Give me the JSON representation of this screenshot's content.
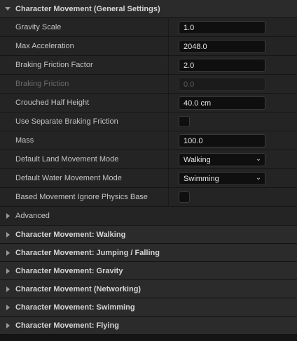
{
  "main_section": {
    "title": "Character Movement (General Settings)",
    "expanded": true,
    "arrow_icon": "chevron-down-icon"
  },
  "properties": [
    {
      "label": "Gravity Scale",
      "type": "number",
      "value": "1.0",
      "enabled": true
    },
    {
      "label": "Max Acceleration",
      "type": "number",
      "value": "2048.0",
      "enabled": true
    },
    {
      "label": "Braking Friction Factor",
      "type": "number",
      "value": "2.0",
      "enabled": true
    },
    {
      "label": "Braking Friction",
      "type": "number",
      "value": "0.0",
      "enabled": false
    },
    {
      "label": "Crouched Half Height",
      "type": "number",
      "value": "40.0 cm",
      "enabled": true
    },
    {
      "label": "Use Separate Braking Friction",
      "type": "checkbox",
      "checked": false,
      "enabled": true
    },
    {
      "label": "Mass",
      "type": "number",
      "value": "100.0",
      "enabled": true
    },
    {
      "label": "Default Land Movement Mode",
      "type": "dropdown",
      "value": "Walking",
      "enabled": true
    },
    {
      "label": "Default Water Movement Mode",
      "type": "dropdown",
      "value": "Swimming",
      "enabled": true
    },
    {
      "label": "Based Movement Ignore Physics Base",
      "type": "checkbox",
      "checked": false,
      "enabled": true
    }
  ],
  "advanced": {
    "label": "Advanced",
    "arrow_icon": "chevron-right-icon"
  },
  "collapsed_sections": [
    {
      "title": "Character Movement: Walking"
    },
    {
      "title": "Character Movement: Jumping / Falling"
    },
    {
      "title": "Character Movement: Gravity"
    },
    {
      "title": "Character Movement (Networking)"
    },
    {
      "title": "Character Movement: Swimming"
    },
    {
      "title": "Character Movement: Flying"
    }
  ],
  "colors": {
    "background": "#151515",
    "row_background": "#242424",
    "header_background": "#2b2b2b",
    "field_background": "#0f0f0f"
  }
}
